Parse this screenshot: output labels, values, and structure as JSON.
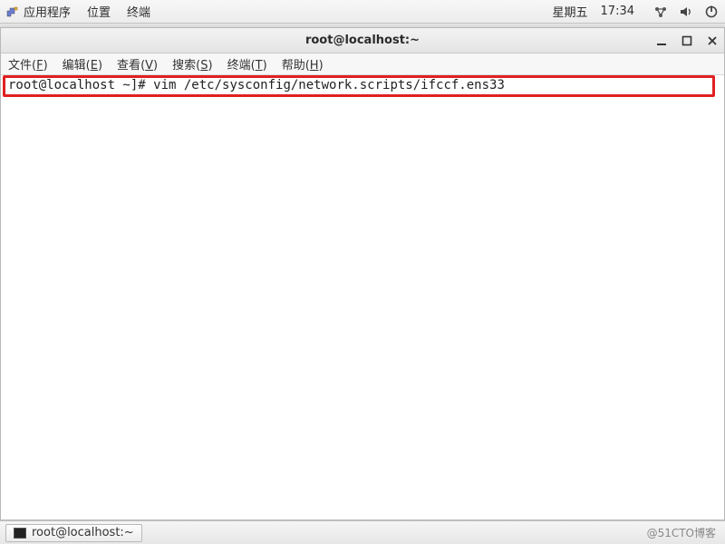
{
  "panel": {
    "applications": "应用程序",
    "places": "位置",
    "terminal": "终端",
    "day": "星期五",
    "time": "17:34"
  },
  "window": {
    "title": "root@localhost:~"
  },
  "menubar": {
    "file": "文件",
    "file_k": "F",
    "edit": "编辑",
    "edit_k": "E",
    "view": "查看",
    "view_k": "V",
    "search": "搜索",
    "search_k": "S",
    "term": "终端",
    "term_k": "T",
    "help": "帮助",
    "help_k": "H"
  },
  "terminal": {
    "prompt": "root@localhost ~]# ",
    "command": "vim /etc/sysconfig/network.scripts/ifccf.ens33"
  },
  "taskbar": {
    "task1": "root@localhost:~"
  },
  "watermark": "@51CTO博客"
}
